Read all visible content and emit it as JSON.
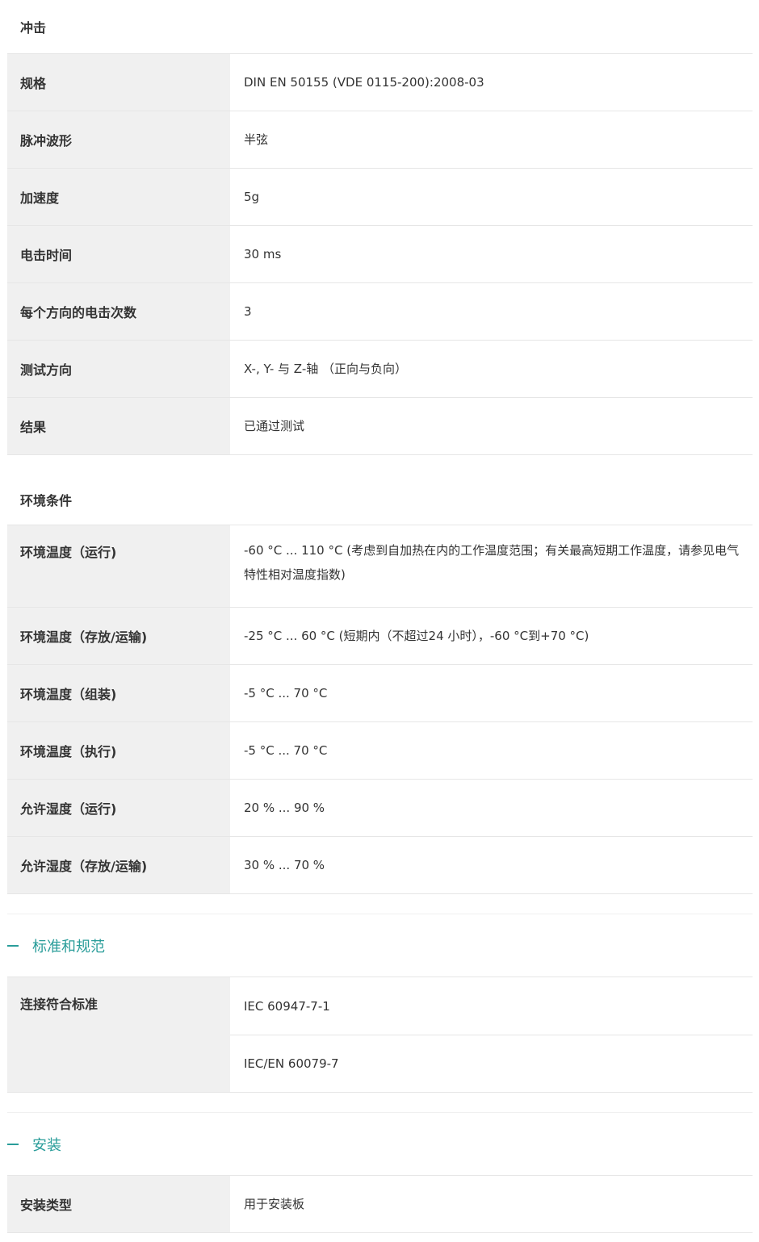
{
  "shock": {
    "title": "冲击",
    "rows": [
      {
        "label": "规格",
        "value": "DIN EN 50155 (VDE 0115-200):2008-03"
      },
      {
        "label": "脉冲波形",
        "value": "半弦"
      },
      {
        "label": "加速度",
        "value": "5g"
      },
      {
        "label": "电击时间",
        "value": "30 ms"
      },
      {
        "label": "每个方向的电击次数",
        "value": "3"
      },
      {
        "label": "测试方向",
        "value": "X-, Y- 与 Z-轴 （正向与负向）"
      },
      {
        "label": "结果",
        "value": "已通过测试"
      }
    ]
  },
  "environment": {
    "title": "环境条件",
    "rows": [
      {
        "label": "环境温度（运行)",
        "value": "-60 °C ... 110 °C (考虑到自加热在内的工作温度范围；有关最高短期工作温度，请参见电气特性相对温度指数)"
      },
      {
        "label": "环境温度（存放/运输)",
        "value": "-25 °C ... 60 °C (短期内（不超过24  小时），-60 °C到+70 °C)"
      },
      {
        "label": "环境温度（组装)",
        "value": "-5 °C ... 70 °C"
      },
      {
        "label": "环境温度（执行)",
        "value": "-5 °C ... 70 °C"
      },
      {
        "label": "允许湿度（运行)",
        "value": "20 % ... 90 %"
      },
      {
        "label": "允许湿度（存放/运输)",
        "value": "30 % ... 70 %"
      }
    ]
  },
  "standards": {
    "heading": "标准和规范",
    "label": "连接符合标准",
    "values": [
      "IEC 60947-7-1",
      "IEC/EN 60079-7"
    ]
  },
  "installation": {
    "heading": "安装",
    "rows": [
      {
        "label": "安装类型",
        "value": "用于安装板"
      }
    ]
  },
  "colors": {
    "accent": "#2a9d9a",
    "label_bg": "#f0f0f0"
  },
  "icons": {
    "collapse": "minus-icon"
  }
}
